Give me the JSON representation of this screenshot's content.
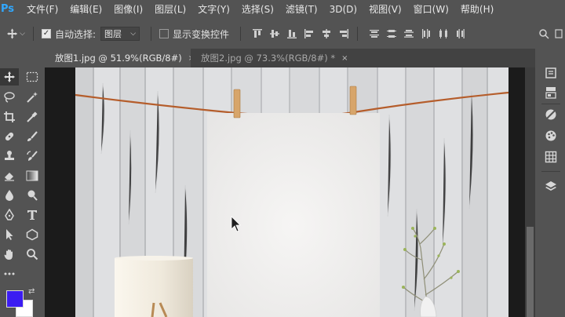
{
  "app": {
    "logo": "Ps",
    "accent_color": "#31a8ff"
  },
  "menu": {
    "items": [
      "文件(F)",
      "编辑(E)",
      "图像(I)",
      "图层(L)",
      "文字(Y)",
      "选择(S)",
      "滤镜(T)",
      "3D(D)",
      "视图(V)",
      "窗口(W)",
      "帮助(H)"
    ]
  },
  "options": {
    "auto_select_label": "自动选择:",
    "auto_select_checked": true,
    "auto_select_target": "图层",
    "show_transform_label": "显示变换控件",
    "show_transform_checked": false
  },
  "tabs": [
    {
      "label": "放图1.jpg @ 51.9%(RGB/8#)",
      "close": "×",
      "active": true
    },
    {
      "label": "放图2.jpg @ 73.3%(RGB/8#) *",
      "close": "×",
      "active": false
    }
  ],
  "colors": {
    "foreground": "#3b1cf2",
    "background": "#ffffff"
  },
  "icons": {
    "tools": [
      "move-icon",
      "marquee-icon",
      "lasso-icon",
      "magic-wand-icon",
      "crop-icon",
      "eyedropper-icon",
      "healing-brush-icon",
      "brush-icon",
      "clone-stamp-icon",
      "history-brush-icon",
      "eraser-icon",
      "gradient-icon",
      "blur-icon",
      "dodge-icon",
      "pen-icon",
      "type-icon",
      "path-select-icon",
      "shape-icon",
      "hand-icon",
      "zoom-icon",
      "more-tools-icon"
    ],
    "panels": [
      "properties-icon",
      "adjustments-icon",
      "color-icon",
      "swatches-icon",
      "grid-icon",
      "layers-icon"
    ]
  }
}
